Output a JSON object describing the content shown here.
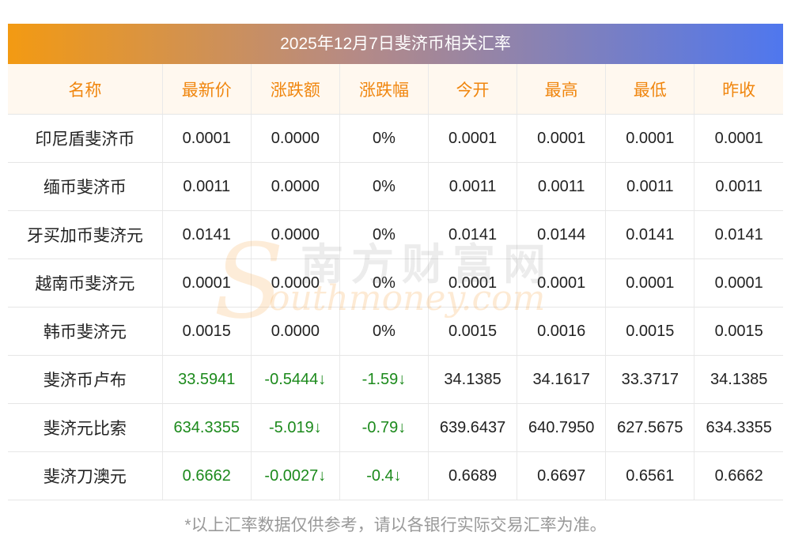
{
  "title": "2025年12月7日斐济币相关汇率",
  "headers": [
    "名称",
    "最新价",
    "涨跌额",
    "涨跌幅",
    "今开",
    "最高",
    "最低",
    "昨收"
  ],
  "rows": [
    {
      "name": "印尼盾斐济币",
      "latest": "0.0001",
      "change": "0.0000",
      "pct": "0%",
      "open": "0.0001",
      "high": "0.0001",
      "low": "0.0001",
      "prev": "0.0001",
      "down": false
    },
    {
      "name": "缅币斐济币",
      "latest": "0.0011",
      "change": "0.0000",
      "pct": "0%",
      "open": "0.0011",
      "high": "0.0011",
      "low": "0.0011",
      "prev": "0.0011",
      "down": false
    },
    {
      "name": "牙买加币斐济元",
      "latest": "0.0141",
      "change": "0.0000",
      "pct": "0%",
      "open": "0.0141",
      "high": "0.0144",
      "low": "0.0141",
      "prev": "0.0141",
      "down": false
    },
    {
      "name": "越南币斐济元",
      "latest": "0.0001",
      "change": "0.0000",
      "pct": "0%",
      "open": "0.0001",
      "high": "0.0001",
      "low": "0.0001",
      "prev": "0.0001",
      "down": false
    },
    {
      "name": "韩币斐济元",
      "latest": "0.0015",
      "change": "0.0000",
      "pct": "0%",
      "open": "0.0015",
      "high": "0.0016",
      "low": "0.0015",
      "prev": "0.0015",
      "down": false
    },
    {
      "name": "斐济币卢布",
      "latest": "33.5941",
      "change": "-0.5444↓",
      "pct": "-1.59↓",
      "open": "34.1385",
      "high": "34.1617",
      "low": "33.3717",
      "prev": "34.1385",
      "down": true
    },
    {
      "name": "斐济元比索",
      "latest": "634.3355",
      "change": "-5.019↓",
      "pct": "-0.79↓",
      "open": "639.6437",
      "high": "640.7950",
      "low": "627.5675",
      "prev": "634.3355",
      "down": true
    },
    {
      "name": "斐济刀澳元",
      "latest": "0.6662",
      "change": "-0.0027↓",
      "pct": "-0.4↓",
      "open": "0.6689",
      "high": "0.6697",
      "low": "0.6561",
      "prev": "0.6662",
      "down": true
    }
  ],
  "watermark": {
    "cn": "南方财富网",
    "en": "outhmoney.com",
    "s": "S"
  },
  "footnote": "*以上汇率数据仅供参考，请以各银行实际交易汇率为准。",
  "colors": {
    "header_text": "#f0860e",
    "header_bg": "#fff8ef",
    "down": "#1c8a1c",
    "gradient_start": "#f39a12",
    "gradient_end": "#4f77ee"
  }
}
